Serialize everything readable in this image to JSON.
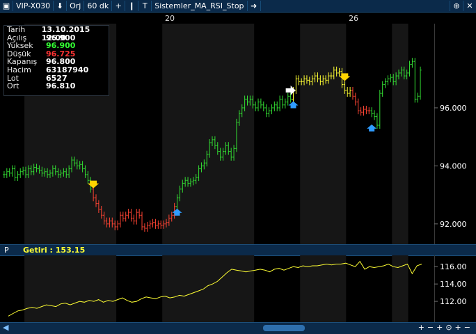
{
  "toolbar": {
    "symbol": "VIP-X030",
    "mode": "Orj",
    "period": "60 dk",
    "system": "Sistemler_MA_RSI_Stop"
  },
  "info": [
    {
      "key": "Tarih",
      "value": "13.10.2015 12:00",
      "color": "#ffffff"
    },
    {
      "key": "Açılış",
      "value": "96.900",
      "color": "#ffffff"
    },
    {
      "key": "Yüksek",
      "value": "96.900",
      "color": "#33ff33"
    },
    {
      "key": "Düşük",
      "value": "96.725",
      "color": "#ff3333"
    },
    {
      "key": "Kapanış",
      "value": "96.800",
      "color": "#ffffff"
    },
    {
      "key": "Hacim",
      "value": "63187940",
      "color": "#ffffff"
    },
    {
      "key": "Lot",
      "value": "6527",
      "color": "#ffffff"
    },
    {
      "key": "Ort",
      "value": "96.810",
      "color": "#ffffff"
    }
  ],
  "xaxis_labels": [
    {
      "text": "20",
      "index": 60
    },
    {
      "text": "26",
      "index": 128
    }
  ],
  "subpanel": {
    "label": "P",
    "return_text": "Getiri : 153.15"
  },
  "colors": {
    "up": "#33dd33",
    "down": "#ff4433",
    "neutral": "#ffff33",
    "buy_arrow": "#2f9cff",
    "sell_arrow": "#ffd400",
    "axis_text": "#ffffff",
    "equity_line": "#ffff33"
  },
  "chart_data": [
    {
      "type": "line",
      "title": "",
      "series_kind": "OHLC bars (60 dk)",
      "y_ticks": [
        92.0,
        94.0,
        96.0
      ],
      "ylim": [
        91.3,
        98.9
      ],
      "grid": false,
      "closes": [
        93.7,
        93.8,
        93.75,
        93.9,
        93.6,
        93.7,
        93.8,
        93.85,
        93.7,
        93.9,
        93.8,
        93.95,
        93.9,
        93.85,
        93.75,
        93.8,
        93.7,
        93.75,
        93.9,
        93.8,
        93.7,
        93.75,
        93.8,
        93.7,
        93.9,
        94.2,
        94.1,
        94.0,
        94.05,
        93.9,
        93.7,
        93.5,
        93.2,
        92.9,
        92.7,
        92.5,
        92.3,
        92.1,
        92.0,
        92.1,
        92.0,
        91.9,
        92.0,
        92.3,
        92.2,
        92.3,
        92.4,
        92.2,
        92.1,
        92.4,
        92.3,
        91.9,
        91.85,
        91.95,
        92.0,
        92.05,
        91.95,
        92.0,
        91.95,
        92.0,
        92.05,
        92.2,
        92.3,
        92.6,
        92.9,
        93.2,
        93.4,
        93.5,
        93.4,
        93.45,
        93.5,
        93.6,
        93.9,
        94.0,
        94.1,
        94.4,
        94.8,
        94.9,
        94.7,
        94.5,
        94.3,
        94.5,
        94.7,
        94.5,
        94.3,
        94.6,
        95.5,
        95.8,
        96.0,
        96.3,
        96.2,
        96.3,
        96.1,
        96.0,
        96.2,
        96.1,
        96.0,
        95.8,
        95.9,
        96.0,
        96.1,
        96.0,
        96.3,
        96.1,
        96.2,
        96.4,
        96.3,
        96.6,
        97.0,
        96.9,
        96.9,
        97.0,
        96.95,
        96.9,
        97.0,
        97.1,
        97.0,
        96.9,
        97.0,
        96.95,
        97.1,
        97.1,
        97.3,
        97.2,
        97.25,
        96.8,
        96.6,
        96.5,
        96.6,
        96.4,
        96.2,
        95.9,
        95.85,
        95.95,
        95.9,
        95.9,
        95.8,
        95.7,
        95.4,
        96.5,
        96.8,
        96.9,
        97.0,
        97.05,
        96.9,
        97.1,
        97.2,
        97.3,
        97.1,
        97.2,
        97.5,
        97.6,
        96.3,
        96.4,
        97.3
      ]
    },
    {
      "type": "line",
      "title": "Getiri : 153.15",
      "series": [
        {
          "name": "Getiri",
          "values": [
            110.3,
            110.6,
            110.9,
            111.0,
            111.2,
            111.3,
            111.2,
            111.4,
            111.6,
            111.5,
            111.4,
            111.7,
            111.8,
            111.6,
            111.8,
            112.0,
            111.9,
            112.1,
            112.0,
            112.2,
            111.9,
            112.1,
            112.0,
            112.2,
            112.4,
            112.1,
            111.9,
            112.0,
            112.3,
            112.5,
            112.4,
            112.3,
            112.5,
            112.6,
            112.4,
            112.5,
            112.7,
            112.6,
            112.8,
            113.0,
            113.2,
            113.4,
            113.8,
            114.0,
            114.3,
            114.8,
            115.3,
            115.7,
            115.6,
            115.5,
            115.4,
            115.5,
            115.6,
            115.7,
            115.6,
            115.4,
            115.7,
            115.8,
            115.6,
            115.8,
            116.0,
            115.9,
            116.1,
            116.0,
            116.1,
            116.1,
            116.2,
            116.3,
            116.2,
            116.3,
            116.3,
            116.4,
            116.2,
            116.0,
            116.6,
            115.7,
            116.0,
            115.9,
            116.0,
            116.1,
            116.3,
            116.0,
            115.9,
            116.1,
            116.3,
            115.2,
            116.1,
            116.3
          ]
        }
      ],
      "y_ticks": [
        112.0,
        114.0,
        116.0
      ],
      "ylim": [
        109.6,
        117.3
      ],
      "grid": false
    }
  ],
  "signals": [
    {
      "type": "sell",
      "bar": 33
    },
    {
      "type": "buy",
      "bar": 64
    },
    {
      "type": "buy",
      "bar": 107
    },
    {
      "type": "sell",
      "bar": 126
    },
    {
      "type": "buy",
      "bar": 136
    }
  ]
}
